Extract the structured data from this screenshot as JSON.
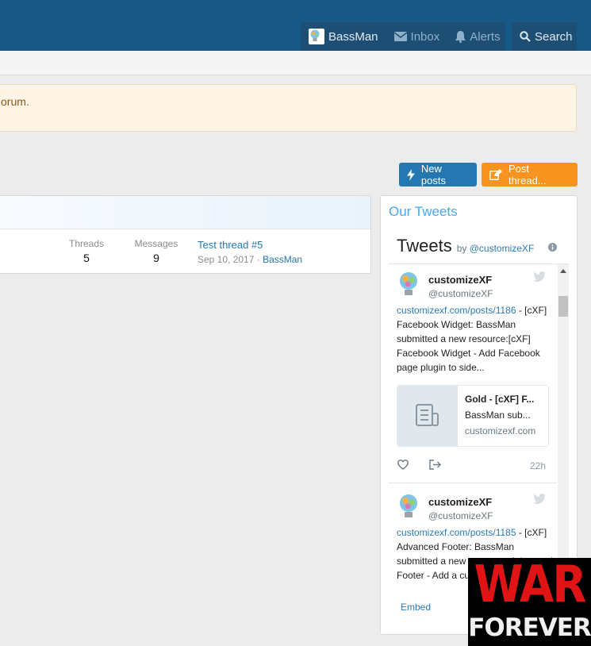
{
  "header": {
    "user_name": "BassMan",
    "inbox_label": "Inbox",
    "alerts_label": "Alerts",
    "search_label": "Search"
  },
  "notice": {
    "text": "orum."
  },
  "actions": {
    "new_posts_label": "New posts",
    "post_thread_label": "Post thread..."
  },
  "forum_row": {
    "threads_label": "Threads",
    "threads_value": "5",
    "messages_label": "Messages",
    "messages_value": "9",
    "latest_title": "Test thread #5",
    "latest_date": "Sep 10, 2017 ·",
    "latest_user": "BassMan"
  },
  "sidebar": {
    "title": "Our Tweets",
    "widget_title": "Tweets",
    "by_label": "by",
    "by_handle": "@customizeXF",
    "embed_label": "Embed"
  },
  "tweets": [
    {
      "name": "customizeXF",
      "handle": "@customizeXF",
      "link": "customizexf.com/posts/1186",
      "text": " - [cXF] Facebook Widget: BassMan submitted a new resource:[cXF] Facebook Widget - Add Facebook page plugin to side...",
      "card_title": "Gold - [cXF] F...",
      "card_desc": "BassMan sub...",
      "card_domain": "customizexf.com",
      "time": "22h"
    },
    {
      "name": "customizeXF",
      "handle": "@customizeXF",
      "link": "customizexf.com/posts/1185",
      "text": " - [cXF] Advanced Footer: BassMan submitted a new resource: Advanced Footer - Add a custom"
    }
  ],
  "watermark": {
    "line1": "WAR",
    "line2": "FOREVER"
  },
  "colors": {
    "topbar": "#185886",
    "blue_button": "#2577b1",
    "orange_button": "#f7931e",
    "notice_bg": "#fff4e5"
  }
}
